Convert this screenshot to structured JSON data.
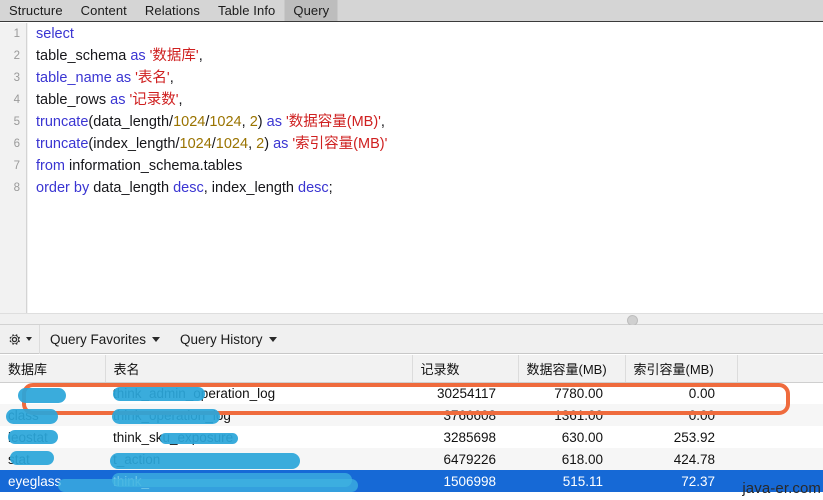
{
  "tabs": [
    {
      "label": "Structure",
      "active": false
    },
    {
      "label": "Content",
      "active": false
    },
    {
      "label": "Relations",
      "active": false
    },
    {
      "label": "Table Info",
      "active": false
    },
    {
      "label": "Query",
      "active": true
    }
  ],
  "editor": {
    "line_numbers": [
      "1",
      "2",
      "3",
      "4",
      "5",
      "6",
      "7",
      "8"
    ],
    "lines": [
      [
        {
          "t": "select",
          "c": "kw"
        }
      ],
      [
        {
          "t": "table_schema ",
          "c": "pln"
        },
        {
          "t": "as ",
          "c": "kw"
        },
        {
          "t": "'数据库'",
          "c": "str"
        },
        {
          "t": ",",
          "c": "pln"
        }
      ],
      [
        {
          "t": "table_name ",
          "c": "kw"
        },
        {
          "t": "as ",
          "c": "kw"
        },
        {
          "t": "'表名'",
          "c": "str"
        },
        {
          "t": ",",
          "c": "pln"
        }
      ],
      [
        {
          "t": "table_rows ",
          "c": "pln"
        },
        {
          "t": "as ",
          "c": "kw"
        },
        {
          "t": "'记录数'",
          "c": "str"
        },
        {
          "t": ",",
          "c": "pln"
        }
      ],
      [
        {
          "t": "truncate",
          "c": "kw"
        },
        {
          "t": "(data_length/",
          "c": "pln"
        },
        {
          "t": "1024",
          "c": "num"
        },
        {
          "t": "/",
          "c": "pln"
        },
        {
          "t": "1024",
          "c": "num"
        },
        {
          "t": ", ",
          "c": "pln"
        },
        {
          "t": "2",
          "c": "num"
        },
        {
          "t": ") ",
          "c": "pln"
        },
        {
          "t": "as ",
          "c": "kw"
        },
        {
          "t": "'数据容量(MB)'",
          "c": "str"
        },
        {
          "t": ",",
          "c": "pln"
        }
      ],
      [
        {
          "t": "truncate",
          "c": "kw"
        },
        {
          "t": "(index_length/",
          "c": "pln"
        },
        {
          "t": "1024",
          "c": "num"
        },
        {
          "t": "/",
          "c": "pln"
        },
        {
          "t": "1024",
          "c": "num"
        },
        {
          "t": ", ",
          "c": "pln"
        },
        {
          "t": "2",
          "c": "num"
        },
        {
          "t": ") ",
          "c": "pln"
        },
        {
          "t": "as ",
          "c": "kw"
        },
        {
          "t": "'索引容量(MB)'",
          "c": "str"
        }
      ],
      [
        {
          "t": "from ",
          "c": "kw"
        },
        {
          "t": "information_schema.tables",
          "c": "pln"
        }
      ],
      [
        {
          "t": "order by ",
          "c": "kw"
        },
        {
          "t": "data_length ",
          "c": "pln"
        },
        {
          "t": "desc",
          "c": "kw"
        },
        {
          "t": ", index_length ",
          "c": "pln"
        },
        {
          "t": "desc",
          "c": "kw"
        },
        {
          "t": ";",
          "c": "pln"
        }
      ]
    ],
    "full_sql": "select\ntable_schema as '数据库',\ntable_name as '表名',\ntable_rows as '记录数',\ntruncate(data_length/1024/1024, 2) as '数据容量(MB)',\ntruncate(index_length/1024/1024, 2) as '索引容量(MB)'\nfrom information_schema.tables\norder by data_length desc, index_length desc;"
  },
  "toolbar": {
    "gear_icon": "gear-icon",
    "query_favorites": "Query Favorites",
    "query_history": "Query History"
  },
  "results": {
    "columns": [
      "数据库",
      "表名",
      "记录数",
      "数据容量(MB)",
      "索引容量(MB)",
      ""
    ],
    "rows": [
      {
        "db": "",
        "table": "_operation_log",
        "table_prefix": "think_admin",
        "rows": "30254117",
        "data_mb": "7780.00",
        "index_mb": "0.00",
        "highlighted": true,
        "selected": false,
        "alt": false
      },
      {
        "db": "class",
        "table": "_operation_log",
        "table_prefix": "think",
        "rows": "3766608",
        "data_mb": "1361.00",
        "index_mb": "0.00",
        "highlighted": false,
        "selected": false,
        "alt": true
      },
      {
        "db": "leostat",
        "table": "think_sku_exposure",
        "table_prefix": "",
        "rows": "3285698",
        "data_mb": "630.00",
        "index_mb": "253.92",
        "highlighted": false,
        "selected": false,
        "alt": false
      },
      {
        "db": "stat",
        "table": "t_action",
        "table_prefix": "",
        "rows": "6479226",
        "data_mb": "618.00",
        "index_mb": "424.78",
        "highlighted": false,
        "selected": false,
        "alt": true
      },
      {
        "db": "eyeglass",
        "table": "think_",
        "table_prefix": "",
        "rows": "1506998",
        "data_mb": "515.11",
        "index_mb": "72.37",
        "highlighted": false,
        "selected": true,
        "alt": false
      }
    ]
  },
  "watermark": {
    "text": "java-er.com"
  },
  "colors": {
    "accent_orange": "#ef6b3d",
    "selection_blue": "#1669d6",
    "redaction_blue": "#2ba6d9",
    "keyword": "#3a35d2",
    "string": "#cf2020",
    "number": "#9a7300"
  }
}
